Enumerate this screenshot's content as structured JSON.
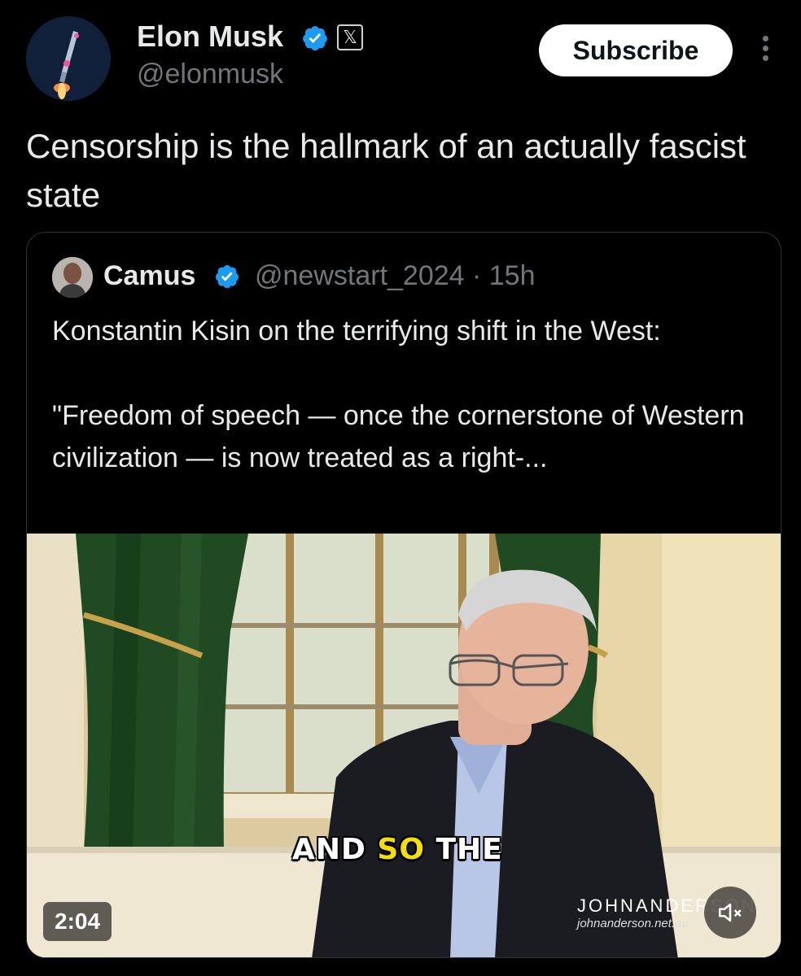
{
  "post": {
    "author_name": "Elon Musk",
    "handle": "@elonmusk",
    "subscribe_label": "Subscribe",
    "text": "Censorship is the hallmark of an actually fascist state"
  },
  "quoted": {
    "author_name": "Camus",
    "handle_time": "@newstart_2024 · 15h",
    "text": "Konstantin Kisin on the terrifying shift in the West:\n\n \"Freedom of speech — once the cornerstone of Western civilization — is now treated as a right-...",
    "video": {
      "caption_part1": "AND ",
      "caption_highlight": "SO",
      "caption_part2": " THE",
      "duration": "2:04",
      "watermark_brand": "JOHNANDERSON",
      "watermark_url": "johnanderson.net.au"
    }
  },
  "icons": {
    "verified": "verified-badge-icon",
    "x_logo": "x-logo-icon",
    "more": "more-vertical-icon",
    "mute": "volume-muted-icon"
  },
  "colors": {
    "background": "#000000",
    "verified_blue": "#1d9bf0",
    "secondary_text": "#71767b",
    "caption_highlight": "#f5e000"
  }
}
